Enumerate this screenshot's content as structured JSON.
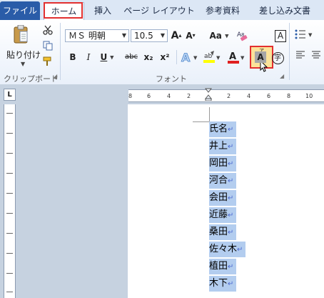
{
  "tabs": {
    "file": "ファイル",
    "home": "ホーム",
    "insert": "挿入",
    "page_layout": "ページ レイアウト",
    "references": "参考資料",
    "mailings": "差し込み文書"
  },
  "clipboard": {
    "paste_label": "貼り付け",
    "group_label": "クリップボード"
  },
  "font": {
    "name": "ＭＳ 明朝",
    "size": "10.5",
    "group_label": "フォント",
    "aa_label": "Aa",
    "bold": "B",
    "italic": "I",
    "underline": "U",
    "strike": "abc",
    "subscript": "x₂",
    "superscript": "x²",
    "grow": "A",
    "shrink": "A",
    "phonetic_top": "ア",
    "phonetic_bottom": "亜",
    "border_char": "A",
    "enclose_char": "字",
    "clear_label": "A"
  },
  "ruler": {
    "box": "L",
    "left_ticks": [
      "8",
      "6",
      "4",
      "2"
    ],
    "right_ticks": [
      "2",
      "4",
      "6",
      "8",
      "10"
    ]
  },
  "document": {
    "lines": [
      "氏名",
      "井上",
      "岡田",
      "河合",
      "会田",
      "近藤",
      "桑田",
      "佐々木",
      "植田",
      "木下"
    ],
    "return_mark": "↵"
  },
  "colors": {
    "accent_red": "#e23030",
    "selection": "#b3cdef",
    "file_tab": "#2a5ca8"
  }
}
